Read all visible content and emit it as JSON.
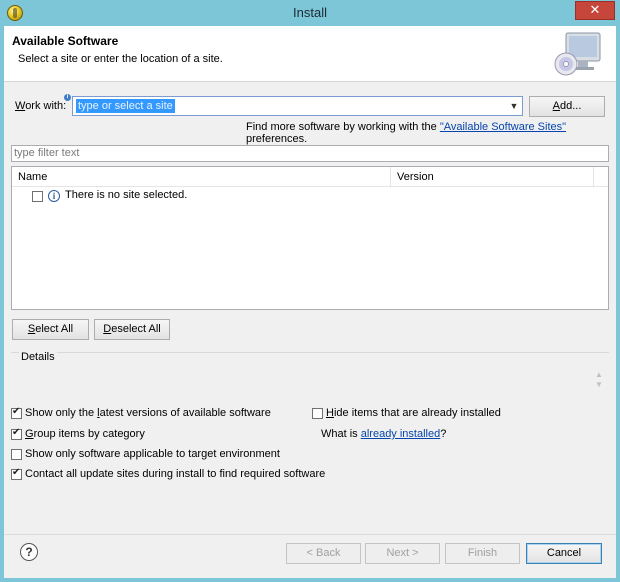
{
  "window": {
    "title": "Install"
  },
  "banner": {
    "title": "Available Software",
    "description": "Select a site or enter the location of a site.",
    "icon": "install-monitor-cd-icon"
  },
  "work_with": {
    "label_prefix": "W",
    "label_rest": "ork with:",
    "value": "type or select a site",
    "add_label_prefix": "A",
    "add_label_rest": "dd..."
  },
  "find_more": {
    "prefix": "Find more software by working with the ",
    "link": "\"Available Software Sites\"",
    "suffix": " preferences."
  },
  "filter": {
    "placeholder": "type filter text"
  },
  "tree": {
    "columns": [
      "Name",
      "Version"
    ],
    "rows": [
      {
        "label": "There is no site selected.",
        "checked": false
      }
    ]
  },
  "buttons": {
    "select_all_prefix": "S",
    "select_all_rest": "elect All",
    "deselect_all_prefix": "D",
    "deselect_all_rest": "eselect All",
    "back": "< Back",
    "back_ul": "B",
    "next": "Next >",
    "finish": "Finish",
    "cancel": "Cancel"
  },
  "details": {
    "label": "Details"
  },
  "options": {
    "latest": {
      "label_a": "Show only the ",
      "label_ul": "l",
      "label_b": "atest versions of available software",
      "checked": true
    },
    "group": {
      "label_a": "",
      "label_ul": "G",
      "label_b": "roup items by category",
      "checked": true
    },
    "target": {
      "label": "Show only software applicable to target environment",
      "checked": false
    },
    "contact": {
      "label": "Contact all update sites during install to find required software",
      "checked": true
    },
    "hide": {
      "label_a": "",
      "label_ul": "H",
      "label_b": "ide items that are already installed",
      "checked": false
    },
    "what_is_prefix": "What is ",
    "what_is_link": "already installed",
    "what_is_suffix": "?"
  }
}
